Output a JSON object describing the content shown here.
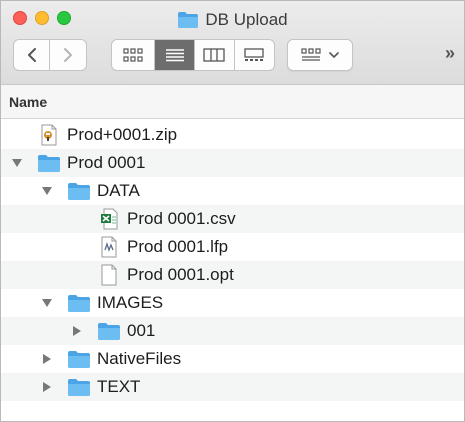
{
  "window": {
    "title": "DB Upload",
    "title_icon": "folder-icon"
  },
  "toolbar": {
    "back_icon": "chevron-left-icon",
    "forward_icon": "chevron-right-icon",
    "view_modes": [
      "icon-view-icon",
      "list-view-icon",
      "column-view-icon",
      "gallery-view-icon"
    ],
    "active_view": "list-view-icon",
    "group_icon": "group-grid-icon",
    "more": "»"
  },
  "header": {
    "name_label": "Name"
  },
  "colors": {
    "folder": "#5fb4ee",
    "folder_dark": "#4aa4e6",
    "stripe": "#f4f5f5",
    "excel": "#1f7a3d"
  },
  "rows": [
    {
      "label": "Prod+0001.zip",
      "icon": "zip-archive-icon",
      "disclosure": "",
      "level": 0
    },
    {
      "label": "Prod 0001",
      "icon": "folder-icon",
      "disclosure": "expanded",
      "level": 0
    },
    {
      "label": "DATA",
      "icon": "folder-icon",
      "disclosure": "expanded",
      "level": 1
    },
    {
      "label": "Prod 0001.csv",
      "icon": "excel-csv-icon",
      "disclosure": "",
      "level": 2
    },
    {
      "label": "Prod 0001.lfp",
      "icon": "lfp-document-icon",
      "disclosure": "",
      "level": 2
    },
    {
      "label": "Prod 0001.opt",
      "icon": "blank-document-icon",
      "disclosure": "",
      "level": 2
    },
    {
      "label": "IMAGES",
      "icon": "folder-icon",
      "disclosure": "expanded",
      "level": 1
    },
    {
      "label": "001",
      "icon": "folder-icon",
      "disclosure": "collapsed",
      "level": 2
    },
    {
      "label": "NativeFiles",
      "icon": "folder-icon",
      "disclosure": "collapsed",
      "level": 1
    },
    {
      "label": "TEXT",
      "icon": "folder-icon",
      "disclosure": "collapsed",
      "level": 1
    }
  ]
}
